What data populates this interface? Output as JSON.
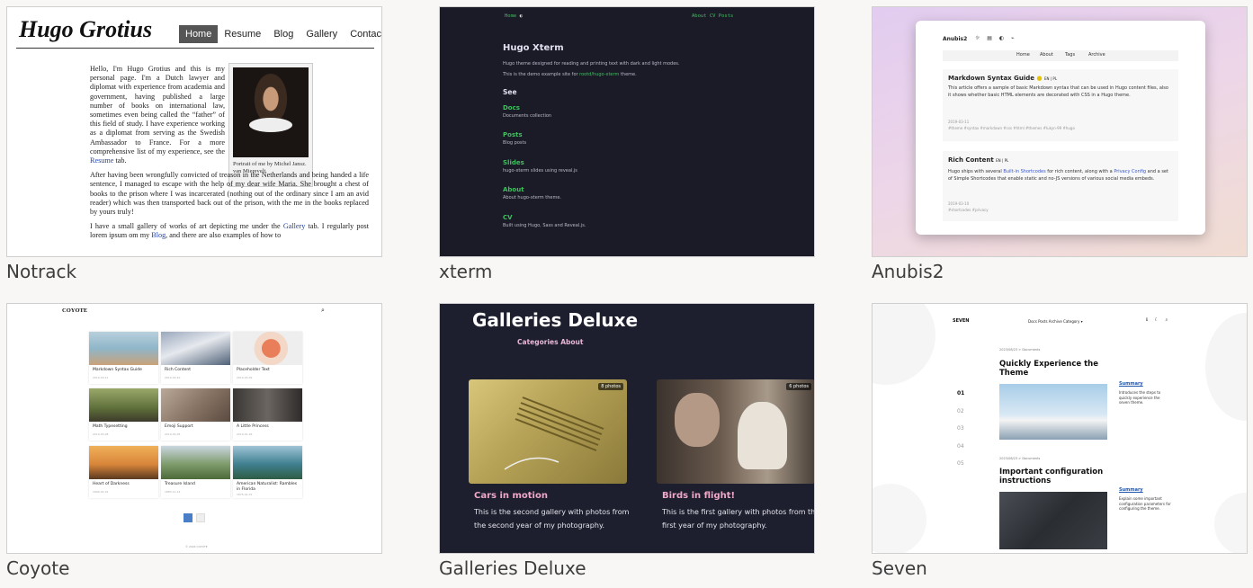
{
  "captions": [
    "Notrack",
    "xterm",
    "Anubis2",
    "Coyote",
    "Galleries Deluxe",
    "Seven"
  ],
  "notrack": {
    "title": "Hugo Grotius",
    "nav": [
      "Home",
      "Resume",
      "Blog",
      "Gallery",
      "Contact"
    ],
    "p1": "Hello, I'm Hugo Grotius and this is my personal page. I'm a Dutch lawyer and diplomat with experience from academia and government, having published a large number of books on international law, sometimes even being called the “father” of this field of study. I have experience working as a diplomat from serving as the Swedish Ambassador to France. For a more comprehensive list of my experience, see the",
    "p1_link": "Resume",
    "p1_end": "tab.",
    "p2": "After having been wrongfully convicted of treason in the Netherlands and being handed a life sentence, I managed to escape with the help of my dear wife Maria. She brought a chest of books to the prison where I was incarcerated (nothing out of the ordinary since I am an avid reader) which was then transported back out of the prison, with the me in the books replaced by yours truly!",
    "p3": "I have a small gallery of works of art depicting me under the",
    "p3_link": "Gallery",
    "p3_mid": "tab. I regularly post lorem ipsum om my",
    "p3_link2": "Blog",
    "p3_end": ", and there are also examples of how to",
    "portrait_caption": "Portrait of me by Michel Jansz. van Mierevelt"
  },
  "xterm": {
    "nav_left": "Home",
    "nav_theme_icon": "contrast-icon",
    "nav_right": "About   CV   Posts",
    "title": "Hugo Xterm",
    "desc": "Hugo theme designed for reading and printing text with dark and light modes.",
    "demo_pre": "This is the demo example site for",
    "demo_link": "rootd/hugo-xterm",
    "demo_post": "theme.",
    "see": "See",
    "items": [
      {
        "label": "Docs",
        "desc": "Documents collection"
      },
      {
        "label": "Posts",
        "desc": "Blog posts"
      },
      {
        "label": "Slides",
        "desc": "hugo-xterm slides using reveal.js"
      },
      {
        "label": "About",
        "desc": "About hugo-xterm theme."
      },
      {
        "label": "CV",
        "desc": "Built using Hugo, Sass and Reveal.js."
      }
    ]
  },
  "anubis": {
    "brand": "Anubis2",
    "icons": "☼ ▤ ◐ ⌁",
    "nav": [
      "Home",
      "About",
      "Tags",
      "Archive"
    ],
    "post1": {
      "title": "Markdown Syntax Guide",
      "langs": "EN | PL",
      "text": "This article offers a sample of basic Markdown syntax that can be used in Hugo content files, also it shows whether basic HTML elements are decorated with CSS in a Hugo theme.",
      "date": "2019-03-11",
      "tags": "#theme  #syntax  #markdown  #css  #html  #themes  #lukyn-99  #hugo"
    },
    "post2": {
      "title": "Rich Content",
      "langs": "EN | PL",
      "t1": "Hugo ships with several",
      "l1": "Built-in Shortcodes",
      "t2": "for rich content, along with a",
      "l2": "Privacy Config",
      "t3": "and a set of Simple Shortcodes that enable static and no-JS versions of various social media embeds.",
      "date": "2019-03-10",
      "tags": "#shortcodes  #privacy"
    }
  },
  "coyote": {
    "logo": "COYOTE",
    "search_icon": "search-icon",
    "tiles": [
      {
        "label": "Markdown Syntax Guide",
        "sub": "2019-03-11",
        "color": "#8fb6c9"
      },
      {
        "label": "Rich Content",
        "sub": "2019-03-10",
        "color": "#6b7f99"
      },
      {
        "label": "Placeholder Text",
        "sub": "2019-03-09",
        "color": "#e9b09a"
      },
      {
        "label": "Math Typesetting",
        "sub": "2019-03-08",
        "color": "#5e6f3a"
      },
      {
        "label": "Emoji Support",
        "sub": "2019-03-05",
        "color": "#8a7666"
      },
      {
        "label": "A Little Princess",
        "sub": "2019-01-26",
        "color": "#4e4a48"
      },
      {
        "label": "Heart of Darkness",
        "sub": "1899-01-01",
        "color": "#d9863a"
      },
      {
        "label": "Treasure Island",
        "sub": "1883-11-14",
        "color": "#7e9b6b"
      },
      {
        "label": "American Naturalist: Rambles in Florida",
        "sub": "1875-01-01",
        "color": "#3f7f8f"
      }
    ],
    "pages": [
      "1",
      "2"
    ],
    "footer": "© 2024 COYOTE"
  },
  "galleries": {
    "title": "Galleries Deluxe",
    "nav": "Categories    About",
    "cards": [
      {
        "badge": "8 photos",
        "title": "Cars in motion",
        "desc": "This is the second gallery with photos from the second year of my photography."
      },
      {
        "badge": "6 photos",
        "title": "Birds in flight!",
        "desc": "This is the first gallery with photos from the first year of my photography."
      }
    ]
  },
  "seven": {
    "logo": "SEVEN",
    "nav": "Docs   Posts   Archive   Category ▾",
    "tools": "ℹ ☾ ⌕",
    "nums": [
      "01",
      "02",
      "03",
      "04",
      "05"
    ],
    "posts": [
      {
        "crumb": "2023/08/23 > Documents",
        "title": "Quickly Experience the Theme",
        "summary": "Summary",
        "desc": "Introduces the steps to quickly experience the seven theme."
      },
      {
        "crumb": "2023/08/23 > Documents",
        "title": "Important configuration instructions",
        "summary": "Summary",
        "desc": "Explain some important configuration parameters for configuring the theme."
      }
    ]
  }
}
